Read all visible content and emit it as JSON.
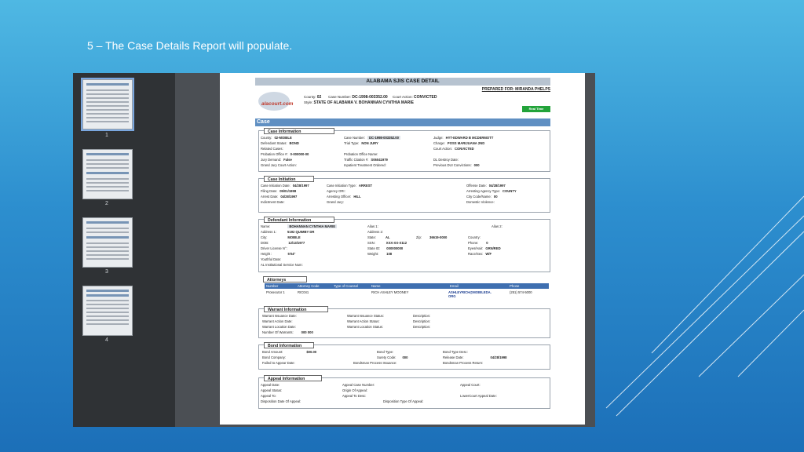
{
  "slide": {
    "title": "5 – The Case Details Report will populate."
  },
  "thumbnails": [
    {
      "label": "1",
      "active": true
    },
    {
      "label": "2",
      "active": false
    },
    {
      "label": "3",
      "active": false
    },
    {
      "label": "4",
      "active": false
    }
  ],
  "report": {
    "title": "ALABAMA SJIS CASE DETAIL",
    "prepared_for": "PREPARED FOR: MIRANDA PHELPS",
    "logo_text": "alacourt.com",
    "county_label": "County:",
    "county_value": "02",
    "case_number_label": "Case Number:",
    "case_number_value": "DC-1998-003352.00",
    "court_action_label": "Court Action:",
    "court_action_value": "CONVICTED",
    "style_label": "Style:",
    "style_value": "STATE OF ALABAMA V. BOHANNAN CYNTHIA MARIE",
    "real_time_button": "Real Time",
    "case_header": "Case"
  },
  "case_information": {
    "heading": "Case Information",
    "fields": {
      "county": {
        "label": "County:",
        "value": "02-MOBILE"
      },
      "defendant_status": {
        "label": "Defendant Status:",
        "value": "BOND"
      },
      "related_cases": {
        "label": "Related Cases:",
        "value": ""
      },
      "probation_office": {
        "label": "Probation Office #:",
        "value": "0-000000-00"
      },
      "jury_demand": {
        "label": "Jury Demand:",
        "value": "False"
      },
      "grand_jury_court_action": {
        "label": "Grand Jury Court Action:",
        "value": ""
      },
      "case_number": {
        "label": "Case Number:",
        "value": "DC-1998-003352.00"
      },
      "trial_type": {
        "label": "Trial Type:",
        "value": "NON JURY"
      },
      "probation_office_name": {
        "label": "Probation Office Name:",
        "value": ""
      },
      "traffic_citation": {
        "label": "Traffic Citation #:",
        "value": "S06041979"
      },
      "inpatient_treatment": {
        "label": "Inpatient Treatment Ordered:",
        "value": ""
      },
      "judge": {
        "label": "Judge:",
        "value": "HYT-EDWARD B MCDERMOTT"
      },
      "charge": {
        "label": "Charge:",
        "value": "POSS MARIJUANA 2ND"
      },
      "court_action": {
        "label": "Court Action:",
        "value": "CONVICTED"
      },
      "dl_destroy_date": {
        "label": "DL Destroy Date:",
        "value": ""
      },
      "previous_dui": {
        "label": "Previous DUI Convictions:",
        "value": "000"
      }
    }
  },
  "case_initiation": {
    "heading": "Case Initiation",
    "fields": {
      "case_initiation_date": {
        "label": "Case Initiation Date:",
        "value": "04/28/1997"
      },
      "filing_date": {
        "label": "Filing Date:",
        "value": "05/01/1998"
      },
      "arrest_date": {
        "label": "Arrest Date:",
        "value": "04/28/1997"
      },
      "indictment_date": {
        "label": "Indictment Date:",
        "value": ""
      },
      "case_initiation_type": {
        "label": "Case Initiation Type:",
        "value": "ARREST"
      },
      "agency_ori": {
        "label": "Agency ORI:",
        "value": ""
      },
      "arresting_officer": {
        "label": "Arresting Officer:",
        "value": "HILL"
      },
      "grand_jury": {
        "label": "Grand Jury:",
        "value": ""
      },
      "offense_date": {
        "label": "Offense Date:",
        "value": "04/28/1997"
      },
      "arresting_agency_type": {
        "label": "Arresting Agency Type:",
        "value": "COUNTY"
      },
      "city_code_name": {
        "label": "City Code/Name:",
        "value": "00"
      },
      "domestic_violence": {
        "label": "Domestic Violence:",
        "value": ""
      }
    }
  },
  "defendant_information": {
    "heading": "Defendant Information",
    "fields": {
      "name": {
        "label": "Name:",
        "value": "BOHANNAN CYNTHIA MARIE"
      },
      "address1": {
        "label": "Address 1:",
        "value": "5192 QUIMBY DR"
      },
      "city": {
        "label": "City:",
        "value": "MOBILE"
      },
      "dob": {
        "label": "DOB:",
        "value": "12/13/1977"
      },
      "driver_license": {
        "label": "Driver License N°:",
        "value": ""
      },
      "height": {
        "label": "Height :",
        "value": "5'04\""
      },
      "youthful_date": {
        "label": "Youthful Date:",
        "value": ""
      },
      "al_institutional": {
        "label": "AL Institutional Service Num:",
        "value": ""
      },
      "alias1": {
        "label": "Alias 1:",
        "value": ""
      },
      "address2": {
        "label": "Address 2:",
        "value": ""
      },
      "state": {
        "label": "State:",
        "value": "AL"
      },
      "zip": {
        "label": "Zip:",
        "value": "36619-0000"
      },
      "ssn": {
        "label": "SSN:",
        "value": "XXX-XX-X112"
      },
      "state_id": {
        "label": "State ID:",
        "value": "000000000"
      },
      "weight": {
        "label": "Weight:",
        "value": "108"
      },
      "alias2": {
        "label": "Alias 2:",
        "value": ""
      },
      "country": {
        "label": "Country:",
        "value": ""
      },
      "phone": {
        "label": "Phone:",
        "value": "0"
      },
      "eyes_hair": {
        "label": "Eyes/Hair:",
        "value": "GRN/RED"
      },
      "race_sex": {
        "label": "Race/Sex:",
        "value": "W/F"
      }
    }
  },
  "attorneys": {
    "heading": "Attorneys",
    "columns": [
      "Number",
      "Attorney Code",
      "Type of Counsel",
      "Name",
      "Email",
      "Phone"
    ],
    "rows": [
      {
        "number": "Prosecutor 1",
        "code": "RIC041",
        "type": "",
        "name": "RICH ASHLEY MOONEY",
        "email": "ASHLEYRICH@MOBILEDA.\nORG",
        "phone": "(251) 574-5000"
      }
    ]
  },
  "warrant_information": {
    "heading": "Warrant Information",
    "fields": {
      "warrant_issuance_date": {
        "label": "Warrant Issuance Date:",
        "value": ""
      },
      "warrant_action_date": {
        "label": "Warrant Action Date:",
        "value": ""
      },
      "warrant_location_date": {
        "label": "Warrant Location Date:",
        "value": ""
      },
      "number_of_warrants": {
        "label": "Number Of Warrants:",
        "value": "000 000"
      },
      "warrant_issuance_status": {
        "label": "Warrant Issuance Status:",
        "value": ""
      },
      "warrant_action_status": {
        "label": "Warrant Action Status:",
        "value": ""
      },
      "warrant_location_status": {
        "label": "Warrant Location Status:",
        "value": ""
      },
      "desc1": {
        "label": "Description:",
        "value": ""
      },
      "desc2": {
        "label": "Description:",
        "value": ""
      },
      "desc3": {
        "label": "Description:",
        "value": ""
      }
    }
  },
  "bond_information": {
    "heading": "Bond Information",
    "fields": {
      "bond_amount": {
        "label": "Bond Amount:",
        "value": "$00.00"
      },
      "bond_company": {
        "label": "Bond Company:",
        "value": ""
      },
      "failed_to_appear": {
        "label": "Failed to Appear Date:",
        "value": ""
      },
      "bond_type": {
        "label": "Bond Type:",
        "value": ""
      },
      "surety_code": {
        "label": "Surety Code:",
        "value": "000"
      },
      "bondsman_issuance": {
        "label": "Bondsman Process Issuance:",
        "value": ""
      },
      "bond_type_desc": {
        "label": "Bond Type Desc:",
        "value": ""
      },
      "release_date": {
        "label": "Release Date:",
        "value": "04/28/1998"
      },
      "bondsman_return": {
        "label": "Bondsman Process Return:",
        "value": ""
      }
    }
  },
  "appeal_information": {
    "heading": "Appeal Information",
    "fields": {
      "appeal_date": {
        "label": "Appeal Date:",
        "value": ""
      },
      "appeal_status": {
        "label": "Appeal Status:",
        "value": ""
      },
      "appeal_to": {
        "label": "Appeal To:",
        "value": ""
      },
      "disposition_date": {
        "label": "Disposition Date Of Appeal:",
        "value": ""
      },
      "appeal_case_number": {
        "label": "Appeal Case Number:",
        "value": ""
      },
      "origin_of_appeal": {
        "label": "Origin Of Appeal:",
        "value": ""
      },
      "appeal_to_desc": {
        "label": "Appeal To Desc:",
        "value": ""
      },
      "disposition_type": {
        "label": "Disposition Type Of Appeal:",
        "value": ""
      },
      "appeal_court": {
        "label": "Appeal Court:",
        "value": ""
      },
      "lower_court_appeal_date": {
        "label": "LowerCourt Appeal Date:",
        "value": ""
      }
    }
  },
  "icons": {
    "logo": "alacourt-logo-icon"
  },
  "colors": {
    "title_bar": "#b7c3d0",
    "case_bar": "#5f8fc2",
    "attorney_header": "#3f6fb0",
    "real_time": "#22a33a"
  }
}
